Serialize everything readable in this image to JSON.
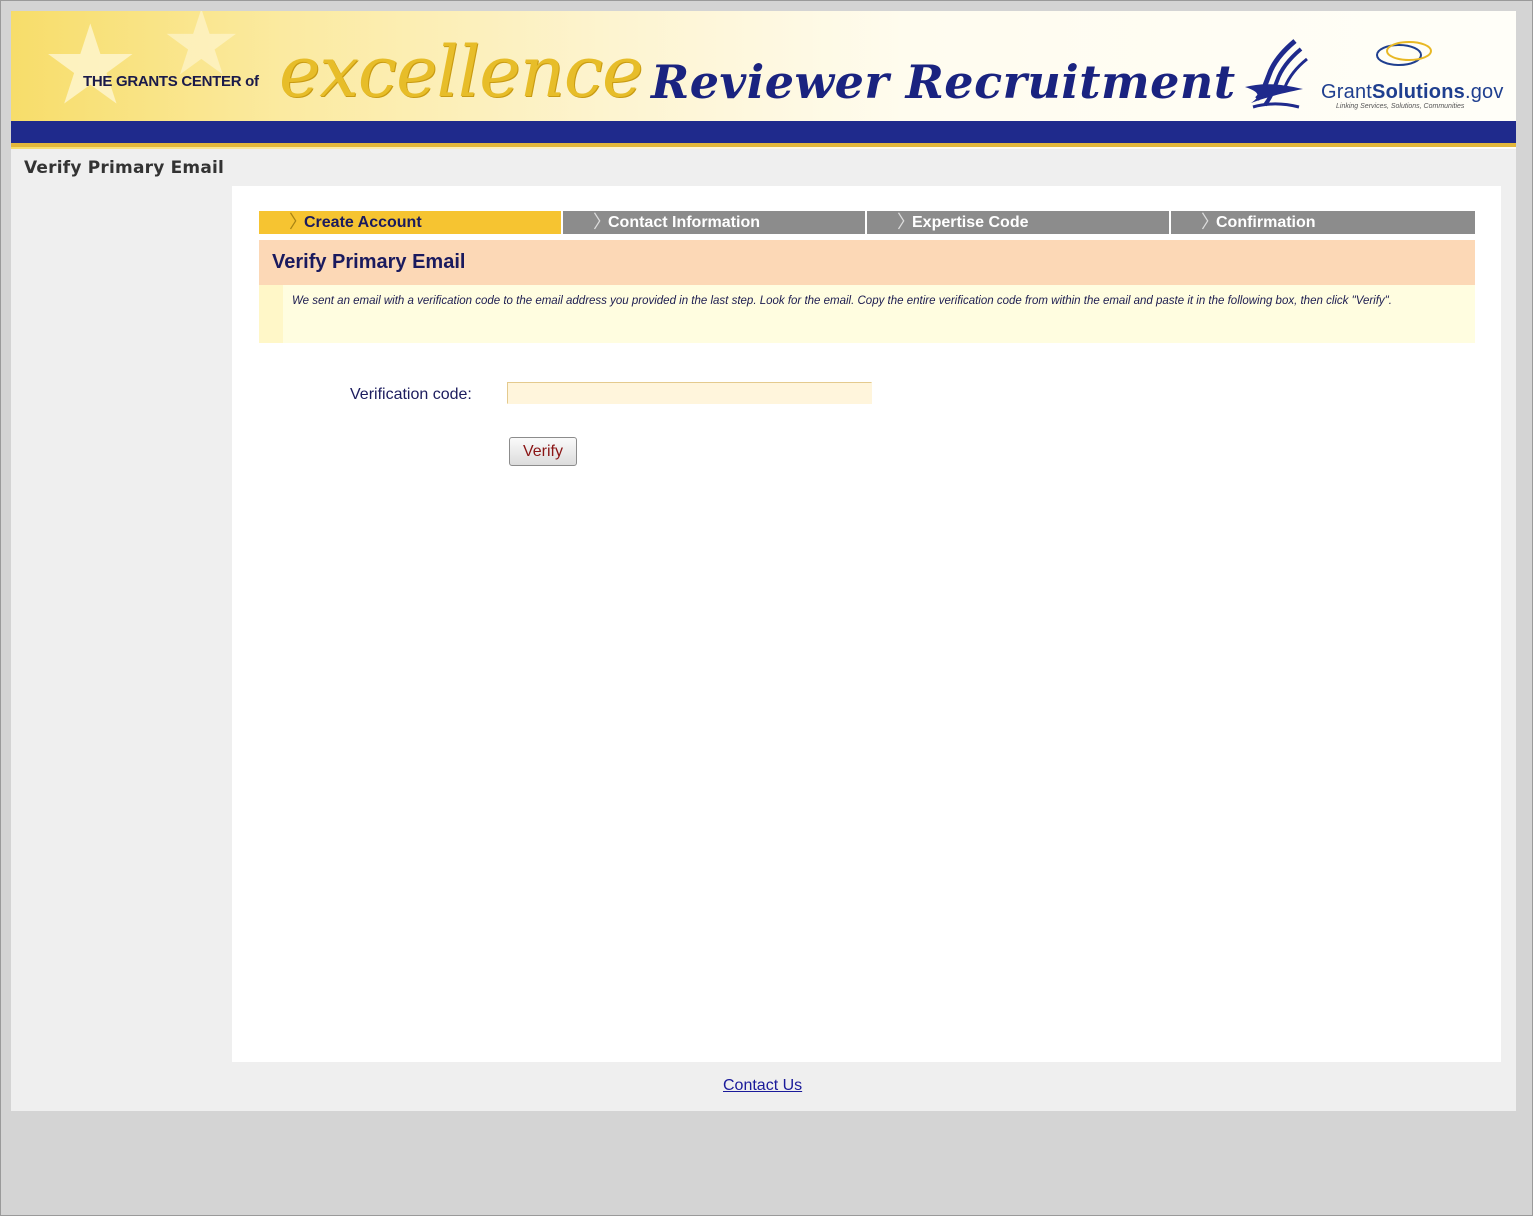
{
  "banner": {
    "brand_small": "THE GRANTS CENTER of",
    "brand_big": "excellence",
    "title": "Reviewer Recruitment",
    "partner_name_prefix": "Grant",
    "partner_name_bold": "Solutions",
    "partner_name_suffix": ".gov",
    "partner_tagline": "Linking Services, Solutions, Communities"
  },
  "page": {
    "heading": "Verify Primary Email"
  },
  "steps": [
    {
      "label": "Create Account",
      "active": true
    },
    {
      "label": "Contact Information",
      "active": false
    },
    {
      "label": "Expertise Code",
      "active": false
    },
    {
      "label": "Confirmation",
      "active": false
    }
  ],
  "section": {
    "title": "Verify Primary Email",
    "instructions": "We sent an email with a verification code to the email address you provided in the last step. Look for the email. Copy the entire verification code from within the email and paste it in the following box, then click \"Verify\"."
  },
  "form": {
    "code_label": "Verification code:",
    "code_value": "",
    "verify_label": "Verify"
  },
  "footer": {
    "contact_label": "Contact Us"
  },
  "colors": {
    "navy": "#1f2a8c",
    "gold": "#f6c431",
    "step_inactive": "#8c8c8c",
    "section_head_bg": "#fcd8b6",
    "notice_bg": "#fffde0"
  }
}
